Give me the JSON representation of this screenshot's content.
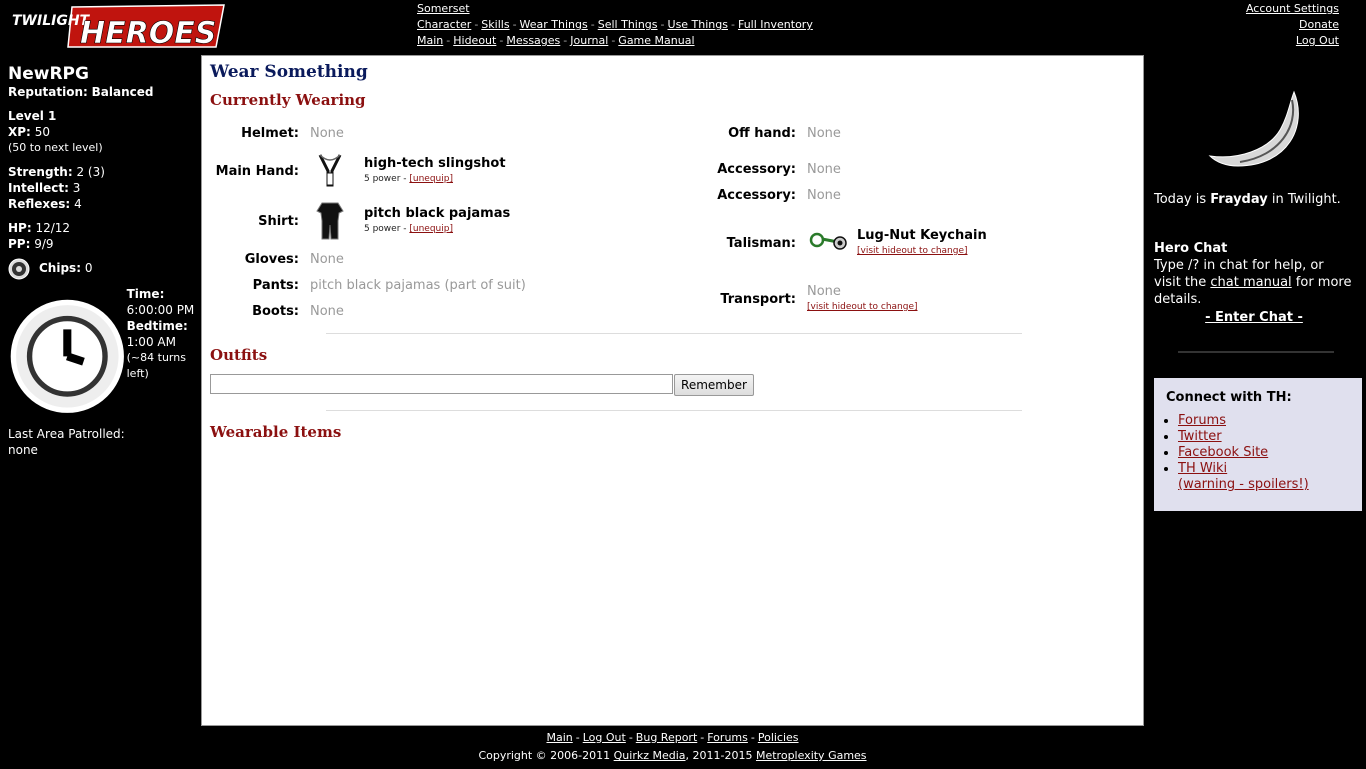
{
  "logo": {
    "line1": "TWILIGHT",
    "line2": "HEROES"
  },
  "topnav": {
    "location": "Somerset",
    "row2": [
      "Character",
      "Skills",
      "Wear Things",
      "Sell Things",
      "Use Things",
      "Full Inventory"
    ],
    "row3": [
      "Main",
      "Hideout",
      "Messages",
      "Journal",
      "Game Manual"
    ],
    "separator": "-"
  },
  "account": {
    "settings": "Account Settings",
    "donate": "Donate",
    "logout": "Log Out"
  },
  "player": {
    "name": "NewRPG",
    "reputation_label": "Reputation:",
    "reputation_value": "Balanced",
    "level": "Level 1",
    "xp_label": "XP:",
    "xp_value": "50",
    "xp_next": "(50 to next level)",
    "strength_label": "Strength:",
    "strength_value": "2 (3)",
    "intellect_label": "Intellect:",
    "intellect_value": "3",
    "reflexes_label": "Reflexes:",
    "reflexes_value": "4",
    "hp_label": "HP:",
    "hp_value": "12/12",
    "pp_label": "PP:",
    "pp_value": "9/9",
    "chips_label": "Chips:",
    "chips_value": "0",
    "time_label": "Time:",
    "time_value": "6:00:00 PM",
    "bedtime_label": "Bedtime:",
    "bedtime_value": "1:00 AM",
    "turns_left": "(~84 turns left)",
    "last_area_label": "Last Area Patrolled:",
    "last_area_value": "none"
  },
  "main": {
    "title": "Wear Something",
    "currently_wearing": "Currently Wearing",
    "outfits": "Outfits",
    "wearable_items": "Wearable Items",
    "remember_button": "Remember",
    "outfit_input_value": "",
    "none_text": "None",
    "slots_left": {
      "helmet": "Helmet:",
      "main_hand": "Main Hand:",
      "shirt": "Shirt:",
      "gloves": "Gloves:",
      "pants": "Pants:",
      "boots": "Boots:"
    },
    "slots_right": {
      "off_hand": "Off hand:",
      "accessory1": "Accessory:",
      "accessory2": "Accessory:",
      "talisman": "Talisman:",
      "transport": "Transport:"
    },
    "main_hand_item": {
      "name": "high-tech slingshot",
      "power": "5 power - ",
      "action": "[unequip]"
    },
    "shirt_item": {
      "name": "pitch black pajamas",
      "power": "5 power - ",
      "action": "[unequip]"
    },
    "pants_value": "pitch black pajamas (part of suit)",
    "talisman_item": {
      "name": "Lug-Nut Keychain",
      "action": "[visit hideout to change]"
    },
    "transport_action": "[visit hideout to change]"
  },
  "footer": {
    "links": [
      "Main",
      "Log Out",
      "Bug Report",
      "Forums",
      "Policies"
    ],
    "copyright_prefix": "Copyright © 2006-2011 ",
    "company1": "Quirkz Media",
    "copyright_mid": ", 2011-2015 ",
    "company2": "Metroplexity Games"
  },
  "rightbar": {
    "today_prefix": "Today is ",
    "today_day": "Frayday",
    "today_suffix": " in Twilight.",
    "chat_title": "Hero Chat",
    "chat_text1": "Type /? in chat for help, or visit the ",
    "chat_link": "chat manual",
    "chat_text2": " for more details.",
    "enter_chat": "- Enter Chat -",
    "connect_title": "Connect with TH:",
    "connect_links": [
      "Forums",
      "Twitter",
      "Facebook Site",
      "TH Wiki",
      "(warning - spoilers!)"
    ]
  },
  "colors": {
    "heading_blue": "#0a1a5c",
    "heading_red": "#8b1010",
    "muted": "#999999",
    "connect_bg": "#e0e0ee"
  },
  "icons": [
    "logo-image",
    "chip-icon",
    "clock-icon",
    "slingshot-icon",
    "pajamas-icon",
    "keychain-icon",
    "moon-image"
  ]
}
